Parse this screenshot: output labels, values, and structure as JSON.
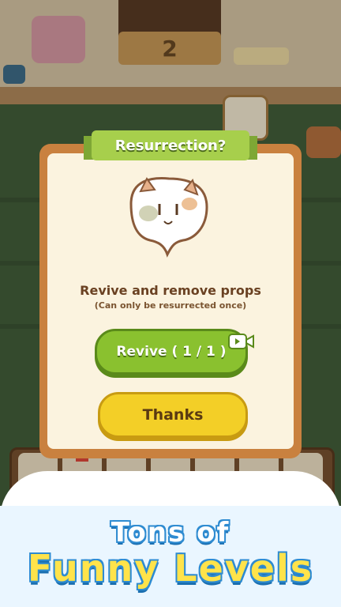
{
  "scene": {
    "level_number": "2"
  },
  "dialog": {
    "title": "Resurrection?",
    "message": "Revive and remove props",
    "note": "(Can only be resurrected once)",
    "revive_button": "Revive ( 1 / 1 )",
    "thanks_button": "Thanks",
    "icons": {
      "ghost": "ghost-cat-icon",
      "video": "video-ad-icon"
    }
  },
  "promo": {
    "line1": "Tons of",
    "line2": "Funny Levels"
  },
  "colors": {
    "revive_green": "#8ac12f",
    "thanks_yellow": "#f3cf27",
    "banner_green": "#a7cf4c",
    "promo_blue": "#2e8bd1"
  }
}
